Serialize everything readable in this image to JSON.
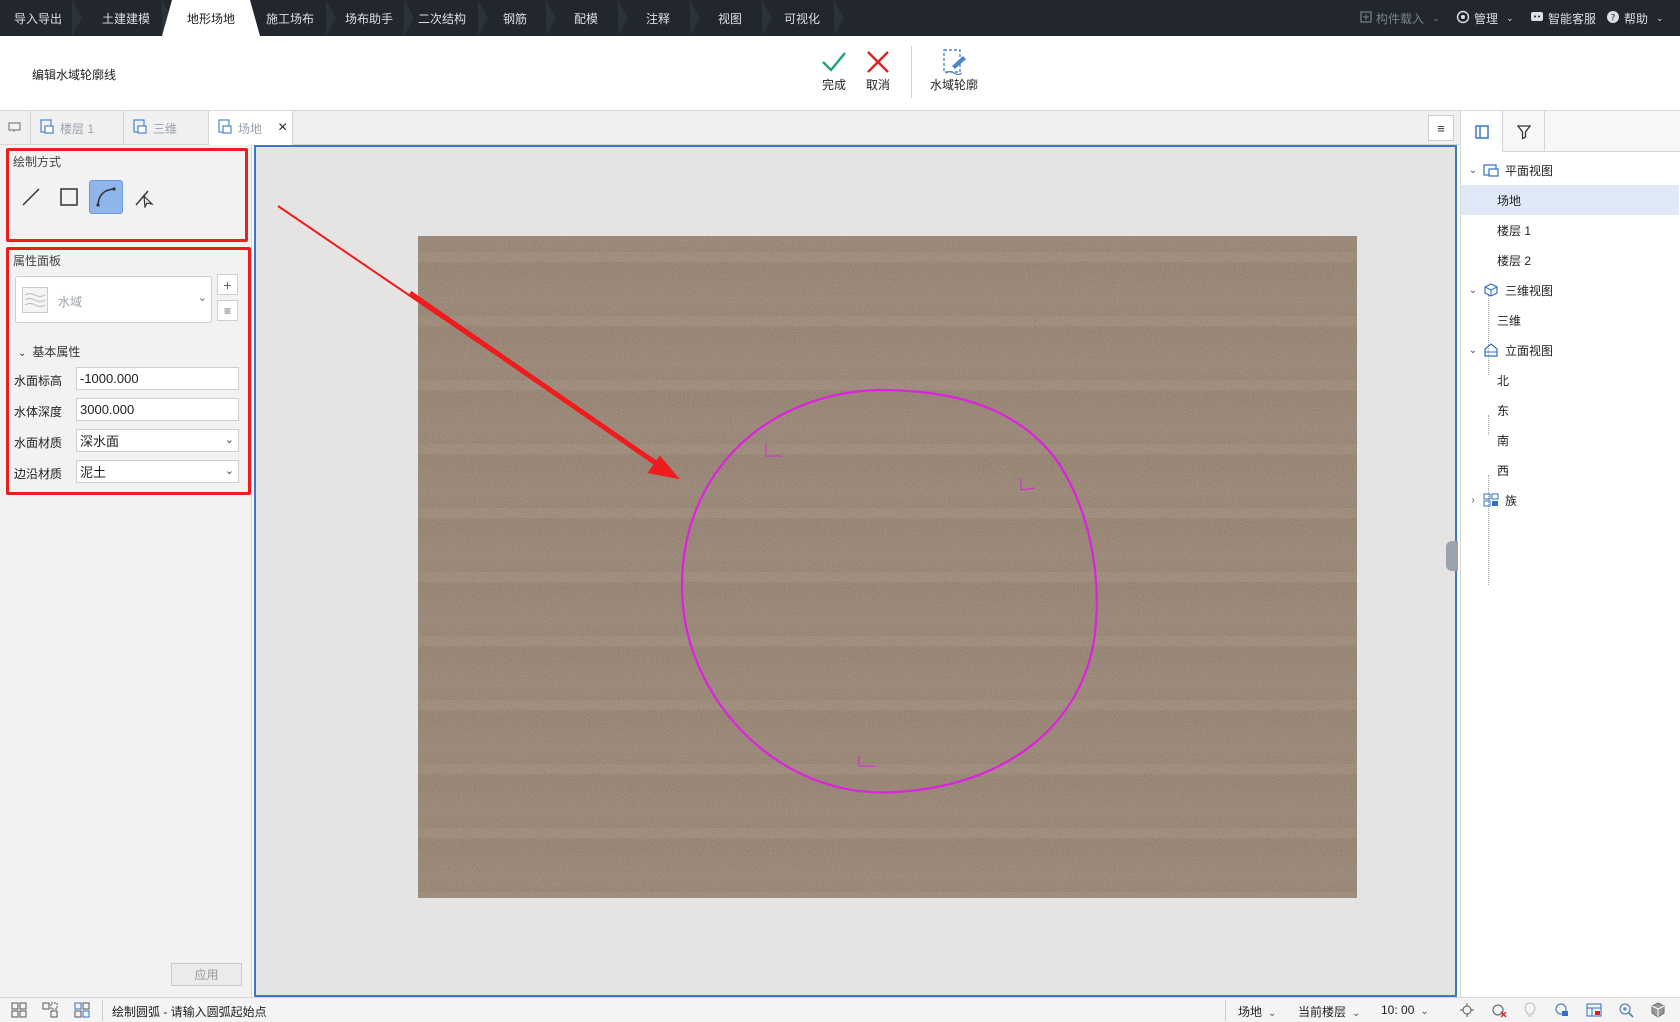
{
  "menu": {
    "tabs": [
      "导入导出",
      "土建建模",
      "地形场地",
      "施工场布",
      "场布助手",
      "二次结构",
      "钢筋",
      "配模",
      "注释",
      "视图",
      "可视化"
    ],
    "active_tab": "地形场地",
    "right": {
      "component_load": "构件载入",
      "manage": "管理",
      "smart_service": "智能客服",
      "help": "帮助"
    }
  },
  "ribbon": {
    "mode_title": "编辑水域轮廓线",
    "finish_label": "完成",
    "cancel_label": "取消",
    "water_outline_label": "水域轮廓"
  },
  "doc_tabs": {
    "items": [
      {
        "label": "楼层 1"
      },
      {
        "label": "三维"
      },
      {
        "label": "场地"
      }
    ],
    "active_index": 2
  },
  "left_panel": {
    "draw_mode_title": "绘制方式",
    "draw_tools": [
      "line-tool",
      "rectangle-tool",
      "arc-tool",
      "pick-tool"
    ],
    "active_draw_tool": "arc-tool",
    "properties_title": "属性面板",
    "type_selector": {
      "value": "水域"
    },
    "group_title": "基本属性",
    "properties": [
      {
        "label": "水面标高",
        "value": "-1000.000",
        "kind": "text"
      },
      {
        "label": "水体深度",
        "value": "3000.000",
        "kind": "text"
      },
      {
        "label": "水面材质",
        "value": "深水面",
        "kind": "select"
      },
      {
        "label": "边沿材质",
        "value": "泥土",
        "kind": "select"
      }
    ],
    "apply_label": "应用"
  },
  "right_panel": {
    "tree": [
      {
        "label": "平面视图",
        "level": 0,
        "expanded": true,
        "icon": "plan-view-icon"
      },
      {
        "label": "场地",
        "level": 1,
        "selected": true
      },
      {
        "label": "楼层 1",
        "level": 1
      },
      {
        "label": "楼层 2",
        "level": 1
      },
      {
        "label": "三维视图",
        "level": 0,
        "expanded": true,
        "icon": "3d-view-icon"
      },
      {
        "label": "三维",
        "level": 1
      },
      {
        "label": "立面视图",
        "level": 0,
        "expanded": true,
        "icon": "elevation-view-icon"
      },
      {
        "label": "北",
        "level": 1
      },
      {
        "label": "东",
        "level": 1
      },
      {
        "label": "南",
        "level": 1
      },
      {
        "label": "西",
        "level": 1
      },
      {
        "label": "族",
        "level": 0,
        "expanded": false,
        "icon": "family-icon"
      }
    ]
  },
  "status_bar": {
    "message": "绘制圆弧 - 请输入圆弧起始点",
    "site": "场地",
    "floor": "当前楼层",
    "scale": "10: 00"
  },
  "colors": {
    "menubar_bg": "#22272e",
    "annotation_red": "#ee1c1c",
    "outline_magenta": "#e020e0",
    "viewport_border": "#3b78c8",
    "terrain": "#8a7666",
    "active_tool": "#8fb6ea"
  }
}
